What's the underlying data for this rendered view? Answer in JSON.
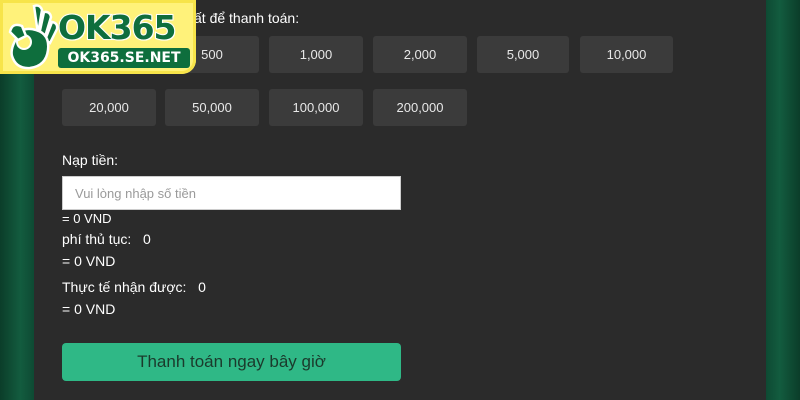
{
  "logo": {
    "brand": "OK365",
    "domain": "OK365.SE.NET"
  },
  "quick_amounts": {
    "label": "ất để thanh toán:",
    "row1": [
      "500",
      "1,000",
      "2,000",
      "5,000",
      "10,000"
    ],
    "row2": [
      "20,000",
      "50,000",
      "100,000",
      "200,000"
    ]
  },
  "deposit": {
    "label": "Nạp tiền:",
    "placeholder": "Vui lòng nhập số tiền",
    "converted": "= 0 VND",
    "fee_label": "phí thủ tục:",
    "fee_value": "0",
    "fee_converted": "= 0 VND",
    "received_label": "Thực tế nhận được:",
    "received_value": "0",
    "received_converted": "= 0 VND"
  },
  "pay_button": {
    "label": "Thanh toán ngay bây giờ"
  },
  "colors": {
    "background": "#0f4a33",
    "panel": "#2b2b2b",
    "amount_button": "#3b3b3b",
    "pay_button": "#2fb886",
    "logo_bg": "#fff27a",
    "logo_green": "#0e6e3d"
  }
}
